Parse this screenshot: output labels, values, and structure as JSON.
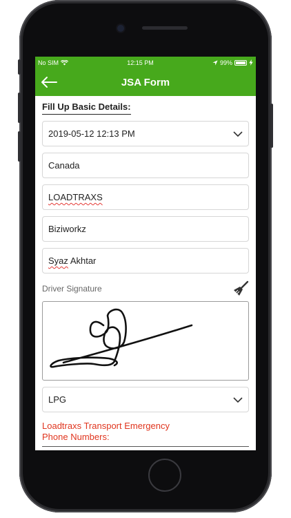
{
  "status_bar": {
    "carrier": "No SIM",
    "time": "12:15 PM",
    "battery": "99%"
  },
  "nav": {
    "title": "JSA Form"
  },
  "form": {
    "section_title": "Fill Up Basic Details:",
    "datetime": "2019-05-12 12:13 PM",
    "country": "Canada",
    "company": "LOADTRAXS",
    "org": "Biziworkz",
    "name": "Syaz Akhtar",
    "signature_label": "Driver Signature",
    "fuel_type": "LPG",
    "emergency_title_line1": "Loadtraxs Transport Emergency",
    "emergency_title_line2": "Phone Numbers:"
  },
  "colors": {
    "header_green": "#47a91c",
    "emergency_red": "#e0351e"
  },
  "icons": [
    "back-arrow-icon",
    "wifi-icon",
    "location-arrow-icon",
    "battery-icon",
    "chevron-down-icon",
    "broom-icon"
  ]
}
